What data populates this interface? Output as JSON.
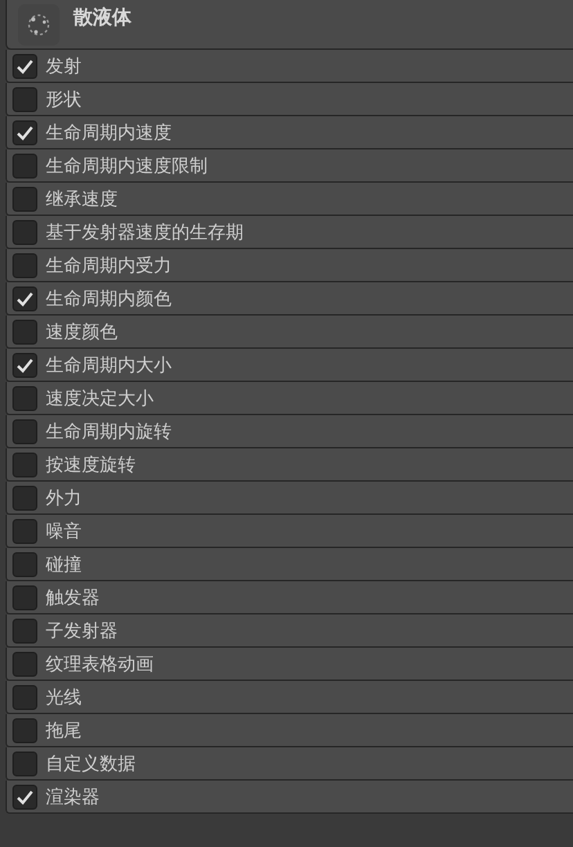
{
  "header": {
    "title": "散液体"
  },
  "modules": [
    {
      "label": "发射",
      "checked": true
    },
    {
      "label": "形状",
      "checked": false
    },
    {
      "label": "生命周期内速度",
      "checked": true
    },
    {
      "label": "生命周期内速度限制",
      "checked": false
    },
    {
      "label": "继承速度",
      "checked": false
    },
    {
      "label": "基于发射器速度的生存期",
      "checked": false
    },
    {
      "label": "生命周期内受力",
      "checked": false
    },
    {
      "label": "生命周期内颜色",
      "checked": true
    },
    {
      "label": "速度颜色",
      "checked": false
    },
    {
      "label": "生命周期内大小",
      "checked": true
    },
    {
      "label": "速度决定大小",
      "checked": false
    },
    {
      "label": "生命周期内旋转",
      "checked": false
    },
    {
      "label": "按速度旋转",
      "checked": false
    },
    {
      "label": "外力",
      "checked": false
    },
    {
      "label": "噪音",
      "checked": false
    },
    {
      "label": "碰撞",
      "checked": false
    },
    {
      "label": "触发器",
      "checked": false
    },
    {
      "label": "子发射器",
      "checked": false
    },
    {
      "label": "纹理表格动画",
      "checked": false
    },
    {
      "label": "光线",
      "checked": false
    },
    {
      "label": "拖尾",
      "checked": false
    },
    {
      "label": "自定义数据",
      "checked": false
    },
    {
      "label": "渲染器",
      "checked": true
    }
  ]
}
